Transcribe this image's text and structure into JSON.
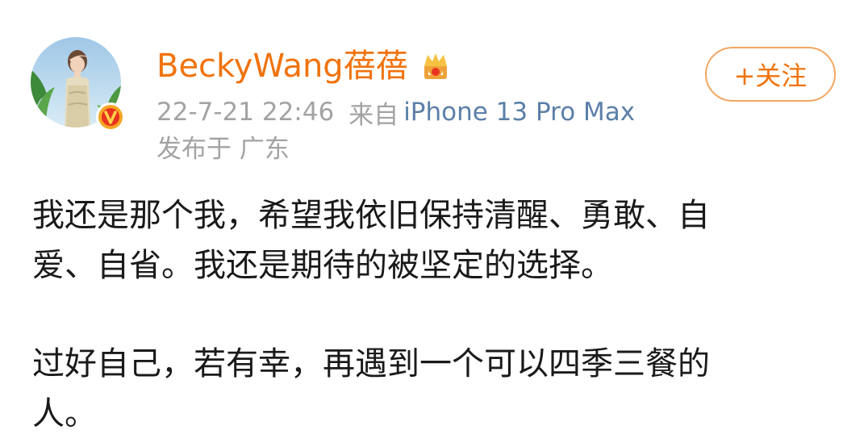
{
  "post": {
    "author": {
      "name": "BeckyWang蓓蓓",
      "avatar": "avatar-photo",
      "verified_icon": "verified-badge-icon",
      "vip_icon": "crown-icon"
    },
    "meta": {
      "date": "22-7-21 22:46",
      "from_label": "来自",
      "device": "iPhone 13 Pro Max",
      "location": "发布于 广东"
    },
    "follow_button": {
      "label": "+关注"
    },
    "body": {
      "paragraph_1": "我还是那个我，希望我依旧保持清醒、勇敢、自\n爱、自省。我还是期待的被坚定的选择。",
      "paragraph_2": "过好自己，若有幸，再遇到一个可以四季三餐的\n人。"
    }
  },
  "colors": {
    "username": "#f0730d",
    "meta_text": "#a3a3a3",
    "device_link": "#5b7fa8",
    "follow_border": "#f2a661",
    "body_text": "#1a1a1a"
  }
}
